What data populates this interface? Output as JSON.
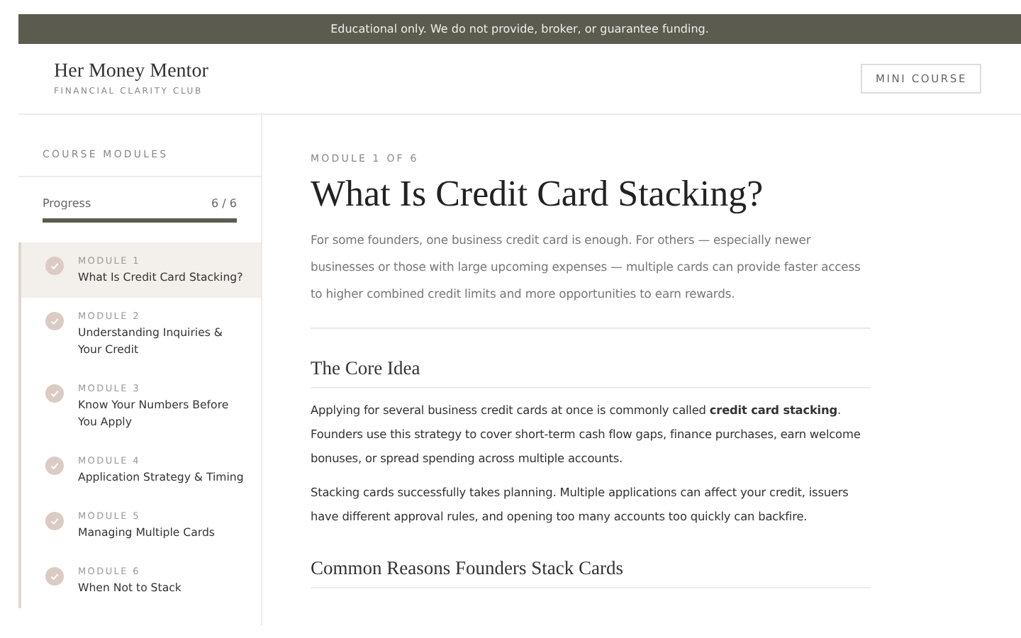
{
  "banner": "Educational only. We do not provide, broker, or guarantee funding.",
  "brand": {
    "name": "Her Money Mentor",
    "tagline": "FINANCIAL CLARITY CLUB"
  },
  "header_button": "MINI COURSE",
  "sidebar": {
    "title": "COURSE MODULES",
    "progress_label": "Progress",
    "progress_count": "6 / 6",
    "level": 1,
    "items": [
      {
        "module": "MODULE 1",
        "title": "What Is Credit Card Stacking?",
        "checked": true,
        "selected": true
      },
      {
        "module": "MODULE 2",
        "title": "Understanding Inquiries & Your Credit",
        "checked": true,
        "selected": false
      },
      {
        "module": "MODULE 3",
        "title": "Know Your Numbers Before You Apply",
        "checked": true,
        "selected": false
      },
      {
        "module": "MODULE 4",
        "title": "Application Strategy & Timing",
        "checked": true,
        "selected": false
      },
      {
        "module": "MODULE 5",
        "title": "Managing Multiple Cards",
        "checked": true,
        "selected": false
      },
      {
        "module": "MODULE 6",
        "title": "When Not to Stack",
        "checked": true,
        "selected": false
      }
    ]
  },
  "main": {
    "eyebrow": "MODULE 1 OF 6",
    "title": "What Is Credit Card Stacking?",
    "intro": "For some founders, one business credit card is enough. For others — especially newer businesses or those with large upcoming expenses — multiple cards can provide faster access to higher combined credit limits and more opportunities to earn rewards.",
    "sections": [
      {
        "heading": "The Core Idea",
        "paragraphs": [
          "Applying for several business credit cards at once is commonly called **credit card stacking**. Founders use this strategy to cover short-term cash flow gaps, finance purchases, earn welcome bonuses, or spread spending across multiple accounts.",
          "Stacking cards successfully takes planning. Multiple applications can affect your credit, issuers have different approval rules, and opening too many accounts too quickly can backfire."
        ]
      },
      {
        "heading": "Common Reasons Founders Stack Cards"
      }
    ]
  }
}
